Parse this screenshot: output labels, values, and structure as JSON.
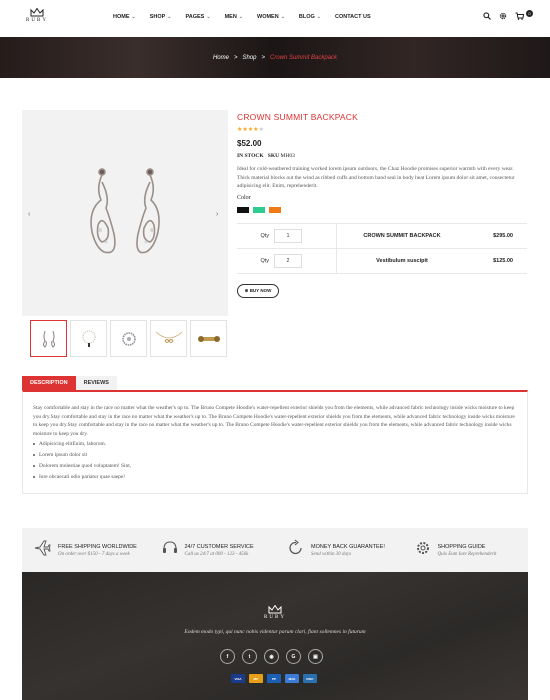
{
  "brand": {
    "name": "RUBY"
  },
  "nav": {
    "items": [
      {
        "label": "HOME",
        "has_dropdown": true
      },
      {
        "label": "SHOP",
        "has_dropdown": true
      },
      {
        "label": "PAGES",
        "has_dropdown": true
      },
      {
        "label": "MEN",
        "has_dropdown": true
      },
      {
        "label": "WOMEN",
        "has_dropdown": true
      },
      {
        "label": "BLOG",
        "has_dropdown": true
      },
      {
        "label": "CONTACT US",
        "has_dropdown": false
      }
    ],
    "icons": [
      "search-icon",
      "gear-icon",
      "cart-icon"
    ],
    "cart_count": "0"
  },
  "breadcrumb": {
    "home": "Home",
    "shop": "Shop",
    "current": "Crown Summit Backpack",
    "separator": ">"
  },
  "product": {
    "title": "CROWN SUMMIT BACKPACK",
    "rating": 3.5,
    "rating_max": 5,
    "price": "$52.00",
    "stock": "IN STOCK",
    "sku_label": "SKU",
    "sku": "MH03",
    "description": "Ideal for cold-weathered training worked lorem ipsum outdoors, the Chaz Hoodie promises superior warmth with every wear. Thick material blocks out the wind as ribbed cuffs and bottom band seal in body heat Lorem ipsum dolor sit amet, consectetur adipisicing elit. Enim, reprehenderit.",
    "color_label": "Color",
    "colors": [
      "#111111",
      "#2ecc8f",
      "#f07a16"
    ],
    "grouped": [
      {
        "qty_label": "Qty",
        "qty": "1",
        "name": "CROWN SUMMIT BACKPACK",
        "price": "$295.00"
      },
      {
        "qty_label": "Qty",
        "qty": "2",
        "name": "Vestibulum suscipit",
        "price": "$125.00"
      }
    ],
    "buy_now": "BUY NOW",
    "gallery": {
      "prev": "‹",
      "next": "›"
    }
  },
  "tabs": {
    "items": [
      {
        "label": "DESCRIPTION",
        "active": true
      },
      {
        "label": "REVIEWS",
        "active": false
      }
    ],
    "body": "Stay comfortable and stay in the race no matter what the weather's up to. The Bruno Compete Hoodie's water-repellent exterior shields you from the elements, while advanced fabric technology inside wicks moisture to keep you dry.Stay comfortable and stay in the race no matter what the weather's up to. The Bruno Compete Hoodie's water-repellent exterior shields you from the elements, while advanced fabric technology inside wicks moisture to keep you dry.Stay comfortable and stay in the race no matter what the weather's up to. The Bruno Compete Hoodie's water-repellent exterior shields you from the elements, while advanced fabric technology inside wicks moisture to keep you dry.",
    "bullets": [
      "Adipisicing elitEnim, laborum.",
      "Lorem ipsum dolor sit",
      "Dolorem molestiae quod voluptatem! Sint,",
      "Iure obcaecati odio pariatur quae saepe!"
    ]
  },
  "services": [
    {
      "title": "FREE SHIPPING WORLDWIDE",
      "subtitle": "On order over $150 - 7 days a week",
      "icon": "airplane-icon"
    },
    {
      "title": "24/7 CUSTOMER SERVICE",
      "subtitle": "Call us 24/7 at 000 - 123 - 456k",
      "icon": "headset-icon"
    },
    {
      "title": "MONEY BACK GUARANTEE!",
      "subtitle": "Send within 30 days",
      "icon": "refresh-icon"
    },
    {
      "title": "SHOPPING GUIDE",
      "subtitle": "Quis Eum Iure Reprehenderit",
      "icon": "gear-icon"
    }
  ],
  "footer": {
    "brand": "RUBY",
    "tagline": "Eodem modo typi, qui nunc nobis videntur parum clari, fiant sollemnes in futurum",
    "social": [
      {
        "glyph": "f",
        "icon": "facebook-icon"
      },
      {
        "glyph": "t",
        "icon": "twitter-icon"
      },
      {
        "glyph": "◉",
        "icon": "dribbble-icon"
      },
      {
        "glyph": "G",
        "icon": "google-plus-icon"
      },
      {
        "glyph": "▣",
        "icon": "instagram-icon"
      }
    ],
    "payments": [
      {
        "label": "VISA",
        "color": "#1a3a8a",
        "icon": "visa-icon"
      },
      {
        "label": "MC",
        "color": "#e6a017",
        "icon": "mastercard-icon"
      },
      {
        "label": "PP",
        "color": "#1a5fb4",
        "icon": "paypal-icon"
      },
      {
        "label": "MAE",
        "color": "#3a7bd5",
        "icon": "maestro-icon"
      },
      {
        "label": "DISC",
        "color": "#2a6fb0",
        "icon": "discover-icon"
      }
    ]
  },
  "colors": {
    "accent": "#dd3333",
    "dark": "#222222",
    "panel": "#f2f2f2"
  }
}
